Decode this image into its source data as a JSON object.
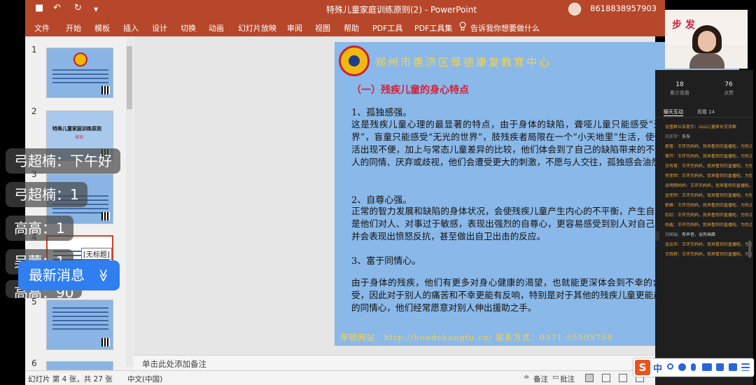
{
  "window": {
    "doc_title": "特殊儿童家庭训练原则(2)  -  PowerPoint",
    "phone": "8618838957903",
    "quick_access": {
      "undo_glyph": "↶",
      "redo_glyph": "↻",
      "save_glyph": "■",
      "dropdown_glyph": "▼"
    }
  },
  "ribbon": {
    "menus": [
      "文件",
      "开始",
      "模板",
      "插入",
      "设计",
      "切换",
      "动画",
      "幻灯片放映",
      "审阅",
      "视图",
      "帮助",
      "PDF工具",
      "PDF工具集"
    ],
    "tell_me": "告诉我你想要做什么"
  },
  "thumbnails": {
    "numbers": [
      "1",
      "2",
      "3",
      "4",
      "5",
      "6"
    ],
    "thumb2_title": "特殊儿童家庭训练原则",
    "thumb2_sub": "培训",
    "thumb4_label": "[无标题]"
  },
  "slide": {
    "org_name": "郑州市惠济区厚德康复教育中心",
    "heading": "（一）残疾儿童的身心特点",
    "sections": [
      {
        "title": "1、孤独感强。",
        "body": "这是残疾儿童心理的最显著的特点，由于身体的缺陷，聋哑儿童只能感受“无声的世界”，盲童只能感受“无光的世界”，肢残疾者局限在一个“小天地里”生活，使他们的生活出现不便，加上与常态儿童差异的比较，他们体会到了自己的缺陷带来的不幸而对别人的同情、厌弃或歧视，他们会遭受更大的刺激，不愿与人交往，孤独感会油然而生。"
      },
      {
        "title": "2、自尊心强。",
        "body": "正常的智力发展和缺陷的身体状况，会使残疾儿童产生内心的不平衡，产生自卑感。于是他们对人、对事过于敏感，表现出强烈的自尊心，更容易感受到别人对自己的伤害，并会表现出愤怒反抗，甚至做出自卫出击的反应。"
      },
      {
        "title": "3、富于同情心。",
        "body": "由于身体的残疾，他们有更多对身心健康的渴望，也就能更深体会到不幸的含义和感受，因此对于别人的痛苦和不幸更能有反响，特别是对于其他的残疾儿童更能产生深刻的同情心，他们经常愿意对别人伸出援助之手。"
      }
    ],
    "footer": "厚德网站：http://houdekangfu.cn/    联系方式：0371-55505758"
  },
  "notes": {
    "placeholder": "单击此处添加备注"
  },
  "overlay": {
    "bubbles": [
      "弓超楠：下午好",
      "弓超楠：1",
      "高高：1",
      "吴蒙：1",
      "高高：90"
    ],
    "latest_button": "最新消息",
    "latest_chevron": "≫"
  },
  "statusbar": {
    "slide_info": "幻灯片 第 4 张，共 27 张",
    "language": "中文(中国)",
    "notes_btn": "备注",
    "comments_btn": "批注"
  },
  "video": {
    "banner_text": "步 发"
  },
  "chat": {
    "stats": [
      {
        "value": "18",
        "label": "累计观看"
      },
      {
        "value": "76",
        "label": "点赞"
      }
    ],
    "tabs": [
      "聊天互动",
      "观看 14"
    ],
    "messages": [
      {
        "name": "设置群公告提示：",
        "text": "山山儿童家长交流群",
        "style": "notice"
      },
      {
        "name": "刘正宇：",
        "text": "东东",
        "style": "plain"
      },
      {
        "name": "郭普：",
        "text": "王环杰妈妈，我来看你的直播啦，为你点赞！",
        "style": "gift"
      },
      {
        "name": "崔开：",
        "text": "王环杰妈妈，我来看你的直播啦，为你点赞！",
        "style": "gift"
      },
      {
        "name": "日有客：",
        "text": "王环杰妈妈，我来看你的直播啦，为你点赞！",
        "style": "gift"
      },
      {
        "name": "何老师：",
        "text": "王环杰妈妈，我来看你的直播啦，为你点赞！",
        "style": "gift"
      },
      {
        "name": "张明雨妈妈：",
        "text": "王环杰妈妈，我来看你的直播啦，为你点赞！",
        "style": "gift"
      },
      {
        "name": "金老师：",
        "text": "王环杰妈妈，我来看你的直播啦，为你点赞！",
        "style": "gift"
      },
      {
        "name": "郭峰：",
        "text": "王环杰妈妈，我来看你的直播啦，为你点赞！",
        "style": "gift"
      },
      {
        "name": "石红：",
        "text": "王环杰妈妈，我来看你的直播啦，为你点赞！",
        "style": "gift"
      },
      {
        "name": "杨鑫：",
        "text": "王环杰妈妈，我来看你的直播啦，为你点赞！",
        "style": "gift"
      },
      {
        "name": "刘国瑞：",
        "text": "有声音，没有画面",
        "style": "plain"
      },
      {
        "name": "金云伟：",
        "text": "王环杰妈妈，我来看你的直播啦，为你点赞！",
        "style": "gift"
      },
      {
        "name": "王晓艳：",
        "text": "王环杰妈妈，我来看你的直播啦，为你点赞！",
        "style": "gift"
      }
    ]
  },
  "ime": {
    "logo": "S",
    "mode": "中"
  },
  "colors": {
    "ppt_red": "#b7472a",
    "slide_blue": "#8ab8e8",
    "gold": "#f5d24a",
    "heading_red": "#d4213a",
    "chat_orange": "#e6a33e",
    "ime_blue": "#2f7ff0"
  }
}
